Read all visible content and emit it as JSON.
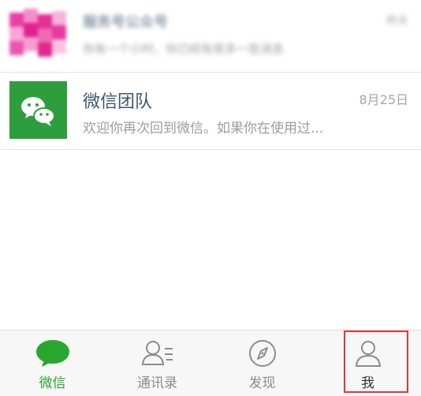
{
  "chats": [
    {
      "name": "服务号公众号",
      "preview": "你有一个小时，你已经有很多一些消息",
      "time": "昨天",
      "blurred": true
    },
    {
      "name": "微信团队",
      "preview": "欢迎你再次回到微信。如果你在使用过...",
      "time": "8月25日",
      "blurred": false
    }
  ],
  "tabs": [
    {
      "label": "微信",
      "icon": "chat-bubble-icon",
      "active": true
    },
    {
      "label": "通讯录",
      "icon": "contacts-icon",
      "active": false
    },
    {
      "label": "发现",
      "icon": "compass-icon",
      "active": false
    },
    {
      "label": "我",
      "icon": "person-icon",
      "active": false
    }
  ],
  "colors": {
    "accent": "#29a62e",
    "wechat_team_avatar": "#2d9e3b",
    "name_text": "#3f5672",
    "highlight_box": "#e8343c"
  }
}
